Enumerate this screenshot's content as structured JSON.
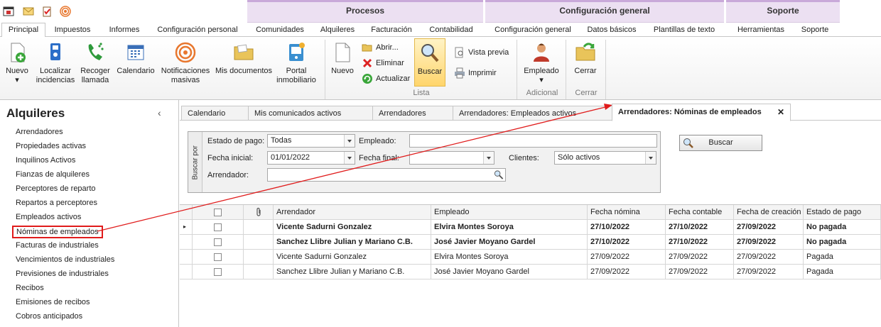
{
  "colors": {
    "accent": "#e01b1b",
    "group_header": "#ece0f2",
    "ribbon": "#f2f2f2"
  },
  "quick_access": [
    {
      "icon": "app-icon"
    },
    {
      "icon": "mail-icon"
    },
    {
      "icon": "clipboard-check-icon"
    },
    {
      "icon": "broadcast-icon"
    }
  ],
  "group_headers": {
    "procesos": "Procesos",
    "config": "Configuración general",
    "soporte": "Soporte"
  },
  "tabs": [
    "Principal",
    "Impuestos",
    "Informes",
    "Configuración personal",
    "Comunidades",
    "Alquileres",
    "Facturación",
    "Contabilidad",
    "Configuración general",
    "Datos básicos",
    "Plantillas de texto",
    "Herramientas",
    "Soporte"
  ],
  "ribbon": {
    "nuevo": "Nuevo",
    "localizar": "Localizar incidencias",
    "recoger": "Recoger llamada",
    "calendario": "Calendario",
    "notificaciones": "Notificaciones masivas",
    "mis_documentos": "Mis documentos",
    "portal": "Portal inmobiliario",
    "nuevo2": "Nuevo",
    "abrir": "Abrir...",
    "eliminar": "Eliminar",
    "actualizar": "Actualizar",
    "buscar": "Buscar",
    "vista_previa": "Vista previa",
    "imprimir": "Imprimir",
    "lista": "Lista",
    "empleado": "Empleado",
    "adicional": "Adicional",
    "cerrar": "Cerrar",
    "cerrar_group": "Cerrar"
  },
  "left": {
    "title": "Alquileres",
    "collapse": "‹",
    "items": [
      "Arrendadores",
      "Propiedades activas",
      "Inquilinos Activos",
      "Fianzas de alquileres",
      "Perceptores de reparto",
      "Repartos a perceptores",
      "Empleados activos",
      "Nóminas de empleados",
      "Facturas de industriales",
      "Vencimientos de industriales",
      "Previsiones de industriales",
      "Recibos",
      "Emisiones de recibos",
      "Cobros anticipados"
    ]
  },
  "doc_tabs": [
    "Calendario",
    "Mis comunicados activos",
    "Arrendadores",
    "Arrendadores: Empleados activos",
    "Arrendadores: Nóminas de empleados"
  ],
  "doc_tab_close": "✕",
  "filter": {
    "side": "Buscar por",
    "estado_label": "Estado de pago:",
    "estado_value": "Todas",
    "empleado_label": "Empleado:",
    "empleado_value": "",
    "fecha_ini_label": "Fecha inicial:",
    "fecha_ini_value": "01/01/2022",
    "fecha_fin_label": "Fecha final:",
    "fecha_fin_value": "",
    "clientes_label": "Clientes:",
    "clientes_value": "Sólo activos",
    "arrendador_label": "Arrendador:",
    "arrendador_value": "",
    "buscar": "Buscar"
  },
  "grid": {
    "headers": [
      "",
      "",
      "Arrendador",
      "Empleado",
      "Fecha nómina",
      "Fecha contable",
      "Fecha de creación",
      "Estado de pago"
    ],
    "rows": [
      {
        "bold": true,
        "arrendador": "Vicente Sadurni Gonzalez",
        "empleado": "Elvira Montes Soroya",
        "fecha_nomina": "27/10/2022",
        "fecha_contable": "27/10/2022",
        "fecha_creacion": "27/09/2022",
        "estado": "No pagada"
      },
      {
        "bold": true,
        "arrendador": "Sanchez Llibre Julian y Mariano C.B.",
        "empleado": "José Javier Moyano Gardel",
        "fecha_nomina": "27/10/2022",
        "fecha_contable": "27/10/2022",
        "fecha_creacion": "27/09/2022",
        "estado": "No pagada"
      },
      {
        "bold": false,
        "arrendador": "Vicente Sadurni Gonzalez",
        "empleado": "Elvira Montes Soroya",
        "fecha_nomina": "27/09/2022",
        "fecha_contable": "27/09/2022",
        "fecha_creacion": "27/09/2022",
        "estado": "Pagada"
      },
      {
        "bold": false,
        "arrendador": "Sanchez Llibre Julian y Mariano C.B.",
        "empleado": "José Javier Moyano Gardel",
        "fecha_nomina": "27/09/2022",
        "fecha_contable": "27/09/2022",
        "fecha_creacion": "27/09/2022",
        "estado": "Pagada"
      }
    ]
  }
}
